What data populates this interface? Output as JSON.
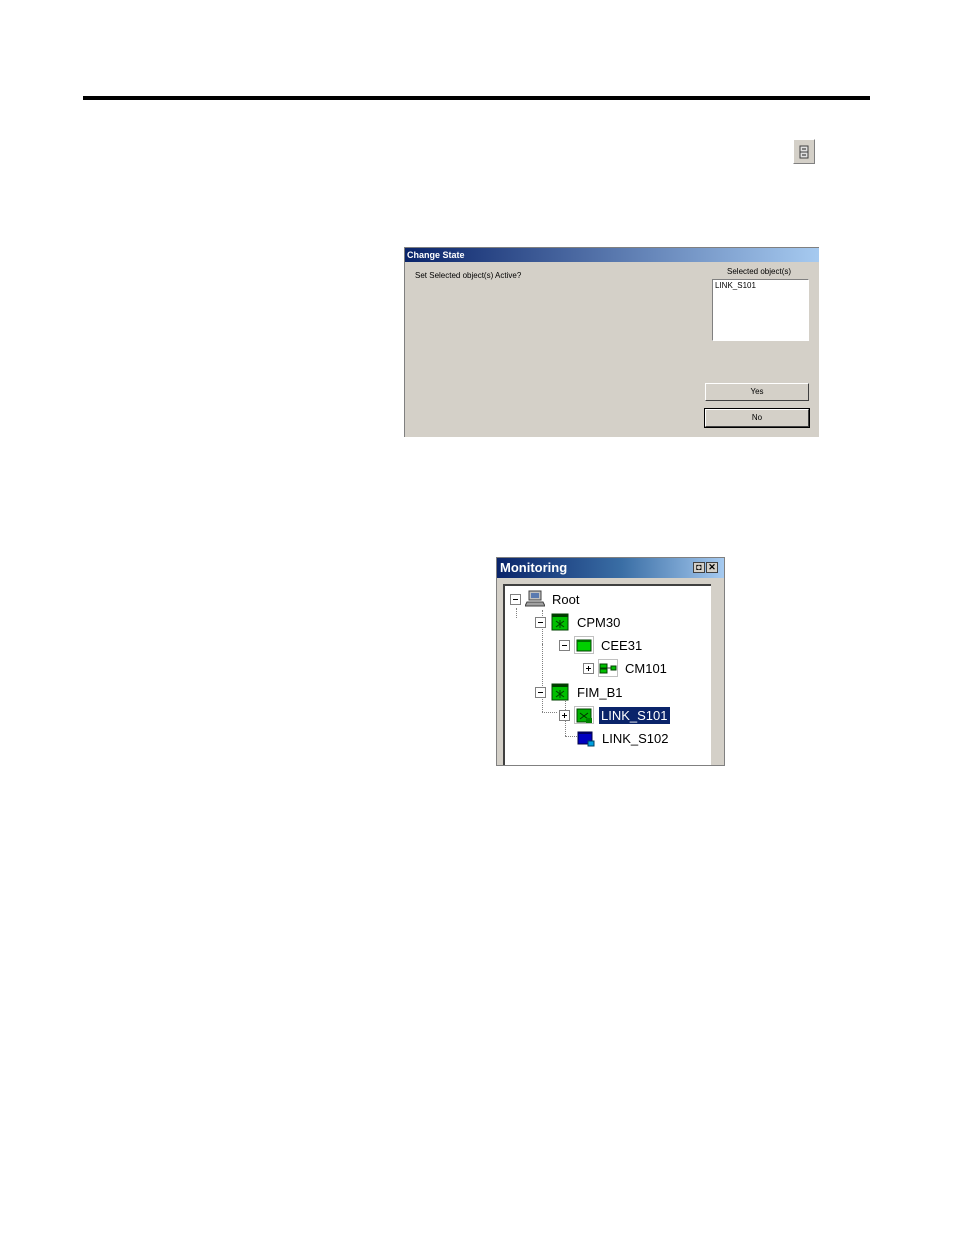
{
  "toolbar": {
    "icon": "change-state-icon"
  },
  "dialog": {
    "title": "Change State",
    "prompt": "Set Selected object(s) Active?",
    "selected_label": "Selected object(s)",
    "selected_items": [
      "LINK_S101"
    ],
    "yes_label": "Yes",
    "no_label": "No"
  },
  "monitoring": {
    "title": "Monitoring",
    "pin_glyph": "◘",
    "close_glyph": "✕",
    "nodes": [
      {
        "label": "Root"
      },
      {
        "label": "CPM30"
      },
      {
        "label": "CEE31"
      },
      {
        "label": "CM101"
      },
      {
        "label": "FIM_B1"
      },
      {
        "label": "LINK_S101"
      },
      {
        "label": "LINK_S102"
      }
    ]
  },
  "colors": {
    "titlebar_dark": "#0a246a",
    "titlebar_light": "#a6caf0",
    "window_face": "#d4d0c8",
    "node_active": "#00c000",
    "node_link": "#0000c0"
  }
}
